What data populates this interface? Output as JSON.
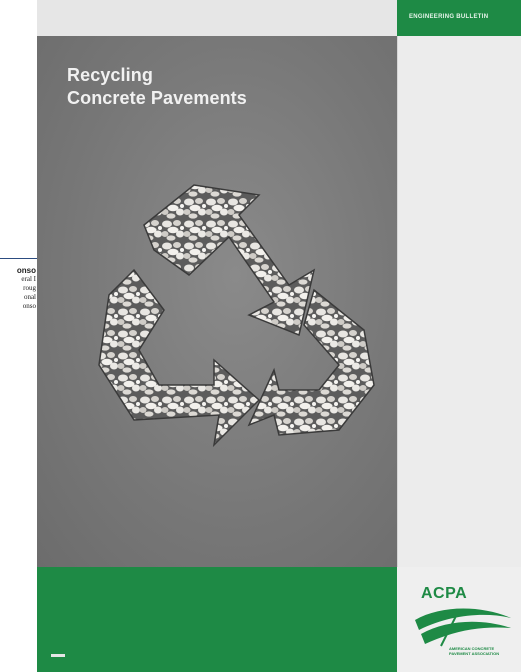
{
  "left_fragment": {
    "lines": [
      "onso",
      "eral I",
      "roug",
      "onal",
      "onso"
    ]
  },
  "cover": {
    "title_line1": "Recycling",
    "title_line2": "Concrete Pavements",
    "footer_mark_color": "#e6e6e6"
  },
  "back": {
    "strip_text": "ENGINEERING BULLETIN",
    "logo_text": "ACPA",
    "logo_small_lines": [
      "AMERICAN CONCRETE",
      "PAVEMENT ASSOCIATION"
    ]
  },
  "colors": {
    "green": "#1e8a45",
    "cover_gray": "#7d7d7d",
    "title_text": "#f1f1f1"
  },
  "icons": [
    "recycle-icon",
    "acpa-logo-icon"
  ]
}
